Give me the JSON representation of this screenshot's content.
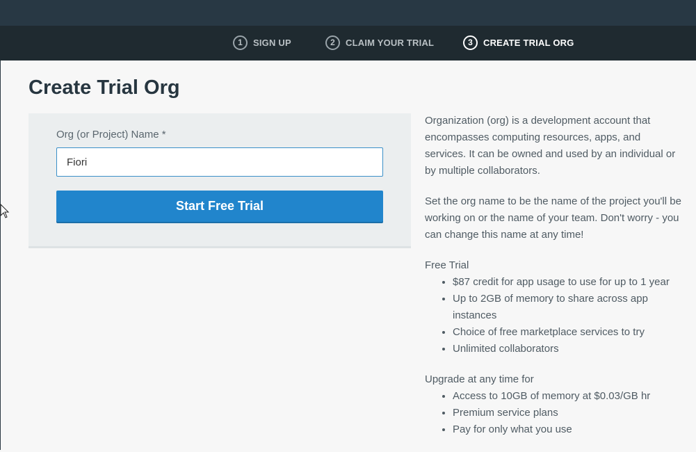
{
  "header": {
    "steps": [
      {
        "number": "1",
        "label": "SIGN UP"
      },
      {
        "number": "2",
        "label": "CLAIM YOUR TRIAL"
      },
      {
        "number": "3",
        "label": "CREATE TRIAL ORG"
      }
    ],
    "active_step": 3
  },
  "page": {
    "title": "Create Trial Org"
  },
  "form": {
    "field_label": "Org (or Project) Name",
    "required_marker": "*",
    "org_name_value": "Fiori",
    "submit_label": "Start Free Trial"
  },
  "info": {
    "paragraph1": "Organization (org) is a development account that encompasses computing resources, apps, and services. It can be owned and used by an individual or by multiple collaborators.",
    "paragraph2": "Set the org name to be the name of the project you'll be working on or the name of your team. Don't worry - you can change this name at any time!",
    "free_trial_title": "Free Trial",
    "free_trial_items": [
      "$87 credit for app usage to use for up to 1 year",
      "Up to 2GB of memory to share across app instances",
      "Choice of free marketplace services to try",
      "Unlimited collaborators"
    ],
    "upgrade_title": "Upgrade at any time for",
    "upgrade_items": [
      "Access to 10GB of memory at $0.03/GB hr",
      "Premium service plans",
      "Pay for only what you use"
    ]
  },
  "colors": {
    "topbar": "#283844",
    "stepbar": "#1f2a30",
    "accent": "#2185cc",
    "title": "#273640"
  },
  "icons": {
    "cursor": "mouse-pointer-icon"
  }
}
